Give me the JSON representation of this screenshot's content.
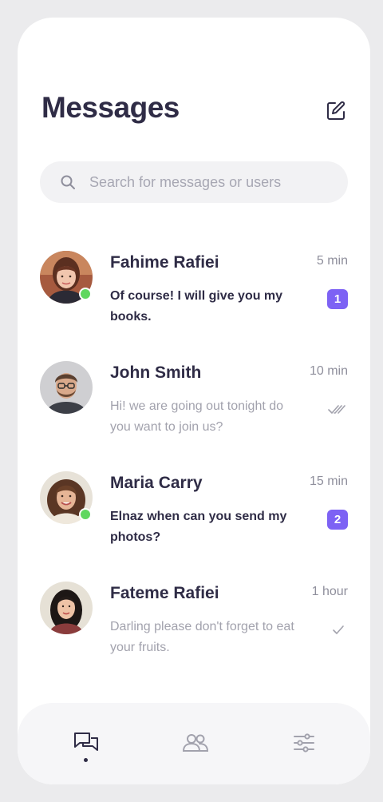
{
  "header": {
    "title": "Messages",
    "compose_icon": "compose-edit-icon"
  },
  "search": {
    "placeholder": "Search for messages or users",
    "value": "",
    "icon": "search-icon"
  },
  "colors": {
    "accent": "#7d62f4",
    "online": "#5fd75f",
    "text_dark": "#2f2c46",
    "text_muted": "#a2a2ad"
  },
  "conversations": [
    {
      "name": "Fahime Rafiei",
      "message": "Of course! I will give you my books.",
      "time": "5 min",
      "unread": true,
      "badge": "1",
      "online": true
    },
    {
      "name": "John Smith",
      "message": "Hi! we are going out tonight do you want to join us?",
      "time": "10 min",
      "unread": false,
      "status": "read-double-check-icon",
      "online": false
    },
    {
      "name": "Maria Carry",
      "message": "Elnaz when can you send my photos?",
      "time": "15 min",
      "unread": true,
      "badge": "2",
      "online": true
    },
    {
      "name": "Fateme Rafiei",
      "message": "Darling please don't forget to eat your fruits.",
      "time": "1 hour",
      "unread": false,
      "status": "sent-check-icon",
      "online": false
    }
  ],
  "tabbar": {
    "tabs": [
      {
        "icon": "chat-bubbles-icon",
        "active": true
      },
      {
        "icon": "users-icon",
        "active": false
      },
      {
        "icon": "sliders-settings-icon",
        "active": false
      }
    ]
  }
}
